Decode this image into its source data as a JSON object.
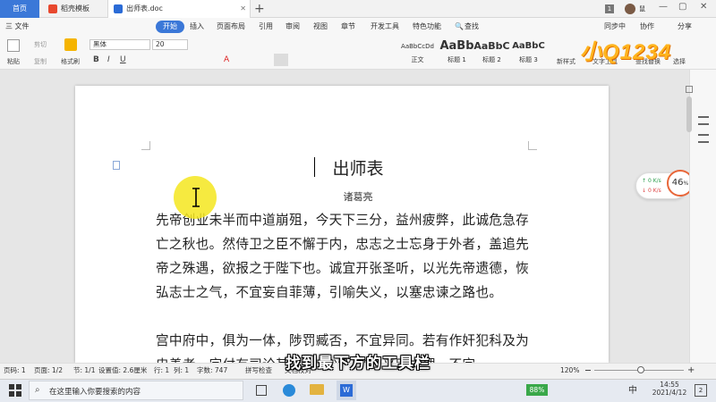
{
  "tabs": {
    "home": "首页",
    "template": "稻壳模板",
    "doc": "出师表.doc",
    "new_tab": "+"
  },
  "titlebar": {
    "badge": "1",
    "user": "鼠"
  },
  "menu": {
    "file": "三 文件",
    "items": [
      "开始",
      "插入",
      "页面布局",
      "引用",
      "审阅",
      "视图",
      "章节",
      "开发工具",
      "特色功能"
    ],
    "search": "查找",
    "sync": "同步中",
    "collab": "协作",
    "share": "分享"
  },
  "ribbon": {
    "cut": "剪切",
    "copy": "复制",
    "paste": "粘贴",
    "format_painter": "格式刷",
    "font_name": "黑体",
    "font_size": "20",
    "styles": [
      {
        "sample": "AaBbCcDd",
        "label": "正文"
      },
      {
        "sample": "AaBb",
        "label": "标题 1"
      },
      {
        "sample": "AaBbC",
        "label": "标题 2"
      },
      {
        "sample": "AaBbC",
        "label": "标题 3"
      }
    ],
    "new_style": "新样式",
    "text_tools": "文字工具",
    "find_replace": "查找替换",
    "select": "选择"
  },
  "document": {
    "title": "出师表",
    "author": "诸葛亮",
    "paragraphs": [
      "先帝创业未半而中道崩殂，今天下三分，益州疲弊，此诚危急存亡之秋也。然侍卫之臣不懈于内，忠志之士忘身于外者，盖追先帝之殊遇，欲报之于陛下也。诚宜开张圣听，以光先帝遗德，恢弘志士之气，不宜妄自菲薄，引喻失义，以塞忠谏之路也。",
      "宫中府中，俱为一体，陟罚臧否，不宜异同。若有作奸犯科及为忠善者，宜付有司论其刑赏，以昭陛下平明之理，不宜"
    ]
  },
  "speed": {
    "up": "0",
    "down": "0",
    "unit": "K/s",
    "percent": "46",
    "percent_sign": "%"
  },
  "logo": "小Q1234",
  "status": {
    "page_num": "页码: 1",
    "page": "页面: 1/2",
    "section": "节: 1/1",
    "setting": "设置值: 2.6厘米",
    "row": "行: 1",
    "col": "列: 1",
    "words": "字数: 747",
    "spell": "拼写检查",
    "doc_check": "文档校对",
    "zoom": "120%"
  },
  "subtitle": "找到最下方的工具栏",
  "taskbar": {
    "search_placeholder": "在这里输入你要搜索的内容",
    "battery": "88%",
    "ime": "中",
    "time": "14:55",
    "date": "2021/4/12",
    "notif": "2"
  }
}
